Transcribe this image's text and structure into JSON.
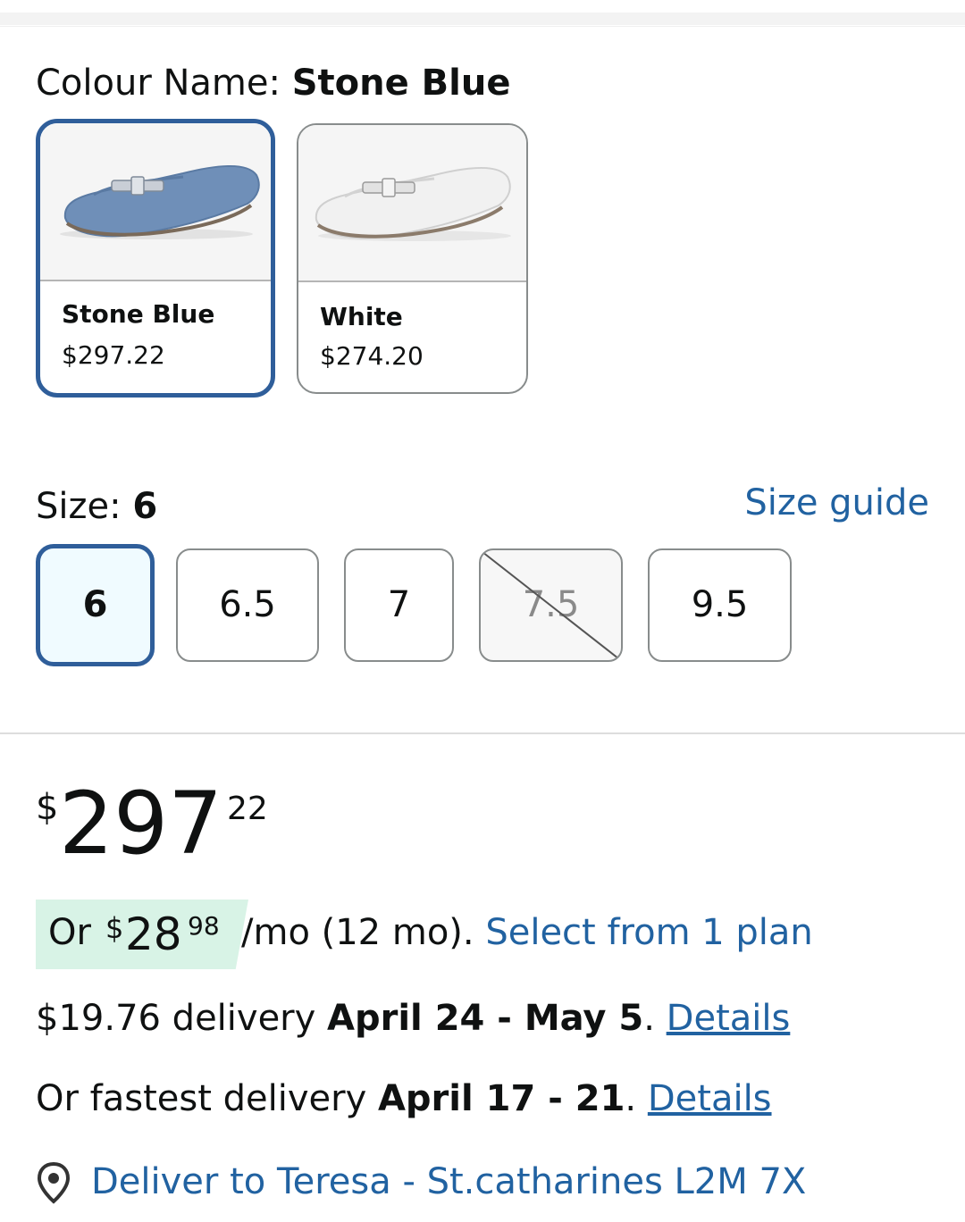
{
  "colour": {
    "label": "Colour Name:",
    "selected": "Stone Blue",
    "options": [
      {
        "name": "Stone Blue",
        "price": "$297.22",
        "color": "#6f8fb8"
      },
      {
        "name": "White",
        "price": "$274.20",
        "color": "#f1f1f1"
      }
    ]
  },
  "size": {
    "label": "Size:",
    "selected": "6",
    "guide": "Size guide",
    "options": [
      {
        "label": "6",
        "state": "selected"
      },
      {
        "label": "6.5",
        "state": "available"
      },
      {
        "label": "7",
        "state": "available"
      },
      {
        "label": "7.5",
        "state": "unavailable"
      },
      {
        "label": "9.5",
        "state": "available"
      }
    ]
  },
  "price": {
    "symbol": "$",
    "whole": "297",
    "fraction": "22"
  },
  "installment": {
    "prefix": "Or",
    "symbol": "$",
    "whole": "28",
    "fraction": "98",
    "suffix": "/mo (12 mo).",
    "link": "Select from 1 plan"
  },
  "delivery": {
    "standard_prefix": "$19.76 delivery",
    "standard_dates": "April 24 - May 5",
    "standard_link": "Details",
    "fastest_prefix": "Or fastest delivery",
    "fastest_dates": "April 17 - 21",
    "fastest_link": "Details",
    "deliver_to": "Deliver to Teresa - St.catharines L2M 7X"
  },
  "colors": {
    "accent_link": "#2162a1",
    "selected_border": "#2f5e9a",
    "installment_bg": "#d8f3e6"
  },
  "icons": {
    "location": "location-pin-icon"
  }
}
